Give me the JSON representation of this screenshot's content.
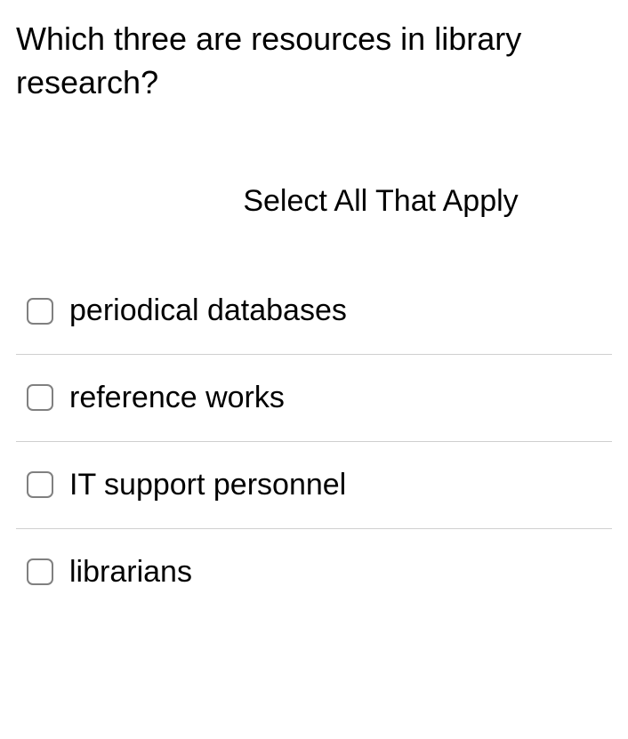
{
  "question": "Which three are resources in library research?",
  "instruction": "Select All That Apply",
  "options": [
    {
      "label": "periodical databases"
    },
    {
      "label": "reference works"
    },
    {
      "label": "IT support personnel"
    },
    {
      "label": "librarians"
    }
  ]
}
